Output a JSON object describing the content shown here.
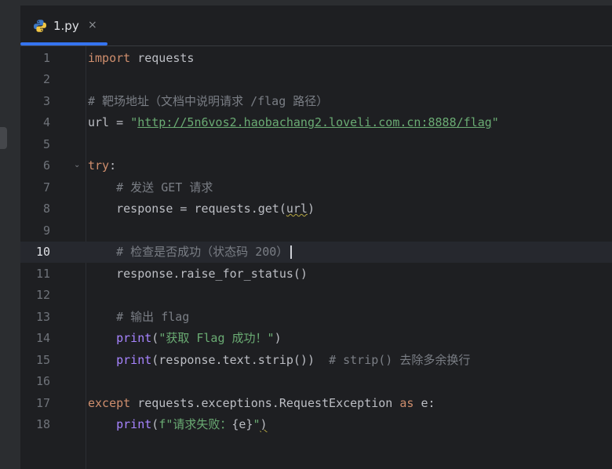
{
  "tab": {
    "label": "1.py",
    "close_glyph": "×",
    "icon": "python-icon"
  },
  "colors": {
    "background": "#1e1f22",
    "keyword": "#cf8e6d",
    "comment": "#7a7e85",
    "string": "#6aab73",
    "builtin": "#a784ff",
    "accent": "#3574f0"
  },
  "editor": {
    "current_line": 10,
    "line_numbers": [
      "1",
      "2",
      "3",
      "4",
      "5",
      "6",
      "7",
      "8",
      "9",
      "10",
      "11",
      "12",
      "13",
      "14",
      "15",
      "16",
      "17",
      "18"
    ],
    "lines": [
      {
        "kw": "import",
        "rest": " requests"
      },
      {},
      {
        "comment": "# 靶场地址（文档中说明请求 /flag 路径）"
      },
      {
        "pre": "url = ",
        "q1": "\"",
        "url": "http://5n6vos2.haobachang2.loveli.com.cn:8888/flag",
        "q2": "\""
      },
      {},
      {
        "kw": "try",
        "colon": ":"
      },
      {
        "comment": "    # 发送 GET 请求"
      },
      {
        "text": "    response = requests.get(",
        "url_word": "url",
        "close": ")"
      },
      {},
      {
        "comment": "    # 检查是否成功（状态码 200）"
      },
      {
        "text": "    response.raise_for_status()"
      },
      {},
      {
        "comment": "    # 输出 flag"
      },
      {
        "indent": "    ",
        "fn": "print",
        "open": "(",
        "str": "\"获取 Flag 成功！\"",
        "close": ")"
      },
      {
        "indent": "    ",
        "fn": "print",
        "mid": "(response.text.strip())  ",
        "comment": "# strip() 去除多余换行"
      },
      {},
      {
        "kw": "except",
        "mid": " requests.exceptions.RequestException ",
        "kw2": "as",
        "rest": " e:"
      },
      {
        "indent": "    ",
        "fn": "print",
        "open": "(",
        "str1": "f\"请求失败：",
        "expr": "{e}",
        "str2": "\"",
        "close": ")"
      }
    ]
  }
}
